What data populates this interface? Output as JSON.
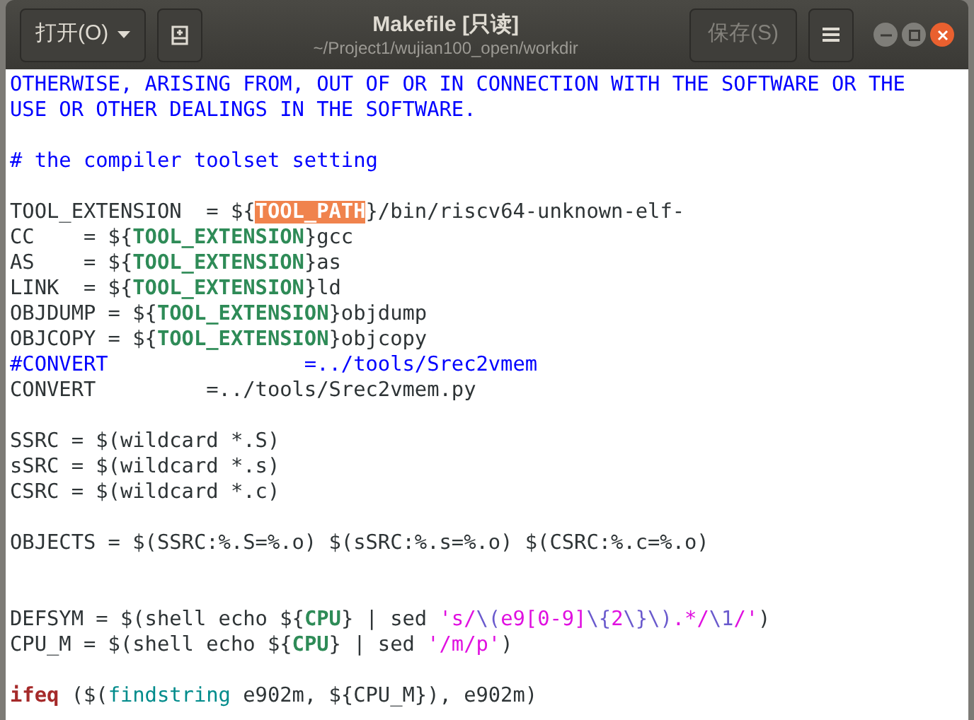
{
  "header": {
    "open_button": {
      "label": "打开(O)"
    },
    "title": "Makefile [只读]",
    "subtitle": "~/Project1/wujian100_open/workdir",
    "save_button": {
      "label": "保存(S)",
      "disabled": true
    }
  },
  "editor": {
    "lines": [
      {
        "kind": "code",
        "segments": [
          {
            "kind": "comment",
            "text": "OTHERWISE, ARISING FROM, OUT OF OR IN CONNECTION WITH THE SOFTWARE OR THE"
          }
        ]
      },
      {
        "kind": "code",
        "segments": [
          {
            "kind": "comment",
            "text": "USE OR OTHER DEALINGS IN THE SOFTWARE."
          }
        ]
      },
      {
        "kind": "blank"
      },
      {
        "kind": "code",
        "segments": [
          {
            "kind": "comment",
            "text": "# the compiler toolset setting"
          }
        ]
      },
      {
        "kind": "blank"
      },
      {
        "kind": "code",
        "segments": [
          {
            "kind": "plain",
            "text": "TOOL_EXTENSION  = ${"
          },
          {
            "kind": "match",
            "text": "TOOL_PATH"
          },
          {
            "kind": "plain",
            "text": "}/bin/riscv64-unknown-elf-"
          }
        ]
      },
      {
        "kind": "code",
        "segments": [
          {
            "kind": "plain",
            "text": "CC    = ${"
          },
          {
            "kind": "variable",
            "text": "TOOL_EXTENSION"
          },
          {
            "kind": "plain",
            "text": "}gcc"
          }
        ]
      },
      {
        "kind": "code",
        "segments": [
          {
            "kind": "plain",
            "text": "AS    = ${"
          },
          {
            "kind": "variable",
            "text": "TOOL_EXTENSION"
          },
          {
            "kind": "plain",
            "text": "}as"
          }
        ]
      },
      {
        "kind": "code",
        "segments": [
          {
            "kind": "plain",
            "text": "LINK  = ${"
          },
          {
            "kind": "variable",
            "text": "TOOL_EXTENSION"
          },
          {
            "kind": "plain",
            "text": "}ld"
          }
        ]
      },
      {
        "kind": "code",
        "segments": [
          {
            "kind": "plain",
            "text": "OBJDUMP = ${"
          },
          {
            "kind": "variable",
            "text": "TOOL_EXTENSION"
          },
          {
            "kind": "plain",
            "text": "}objdump"
          }
        ]
      },
      {
        "kind": "code",
        "segments": [
          {
            "kind": "plain",
            "text": "OBJCOPY = ${"
          },
          {
            "kind": "variable",
            "text": "TOOL_EXTENSION"
          },
          {
            "kind": "plain",
            "text": "}objcopy"
          }
        ]
      },
      {
        "kind": "code",
        "segments": [
          {
            "kind": "comment",
            "text": "#CONVERT                =../tools/Srec2vmem"
          }
        ]
      },
      {
        "kind": "code",
        "segments": [
          {
            "kind": "plain",
            "text": "CONVERT         =../tools/Srec2vmem.py"
          }
        ]
      },
      {
        "kind": "blank"
      },
      {
        "kind": "code",
        "segments": [
          {
            "kind": "plain",
            "text": "SSRC = $(wildcard *.S)"
          }
        ]
      },
      {
        "kind": "code",
        "segments": [
          {
            "kind": "plain",
            "text": "sSRC = $(wildcard *.s)"
          }
        ]
      },
      {
        "kind": "code",
        "segments": [
          {
            "kind": "plain",
            "text": "CSRC = $(wildcard *.c)"
          }
        ]
      },
      {
        "kind": "blank"
      },
      {
        "kind": "code",
        "segments": [
          {
            "kind": "plain",
            "text": "OBJECTS = $(SSRC:%.S=%.o) $(sSRC:%.s=%.o) $(CSRC:%.c=%.o)"
          }
        ]
      },
      {
        "kind": "blank"
      },
      {
        "kind": "blank"
      },
      {
        "kind": "code",
        "segments": [
          {
            "kind": "plain",
            "text": "DEFSYM = $(shell echo ${"
          },
          {
            "kind": "variable",
            "text": "CPU"
          },
          {
            "kind": "plain",
            "text": "} | sed "
          },
          {
            "kind": "string",
            "text": "'s/"
          },
          {
            "kind": "escape",
            "text": "\\("
          },
          {
            "kind": "string",
            "text": "e9[0-9]"
          },
          {
            "kind": "escape",
            "text": "\\{"
          },
          {
            "kind": "string",
            "text": "2"
          },
          {
            "kind": "escape",
            "text": "\\}\\)"
          },
          {
            "kind": "string",
            "text": ".*/"
          },
          {
            "kind": "escape",
            "text": "\\1"
          },
          {
            "kind": "string",
            "text": "/'"
          },
          {
            "kind": "plain",
            "text": ")"
          }
        ]
      },
      {
        "kind": "code",
        "segments": [
          {
            "kind": "plain",
            "text": "CPU_M = $(shell echo ${"
          },
          {
            "kind": "variable",
            "text": "CPU"
          },
          {
            "kind": "plain",
            "text": "} | sed "
          },
          {
            "kind": "string",
            "text": "'/m/p'"
          },
          {
            "kind": "plain",
            "text": ")"
          }
        ]
      },
      {
        "kind": "blank"
      },
      {
        "kind": "code",
        "segments": [
          {
            "kind": "keyword",
            "text": "ifeq"
          },
          {
            "kind": "plain",
            "text": " ($("
          },
          {
            "kind": "function",
            "text": "findstring"
          },
          {
            "kind": "plain",
            "text": " e902m, ${CPU_M}), e902m)"
          }
        ]
      }
    ]
  }
}
